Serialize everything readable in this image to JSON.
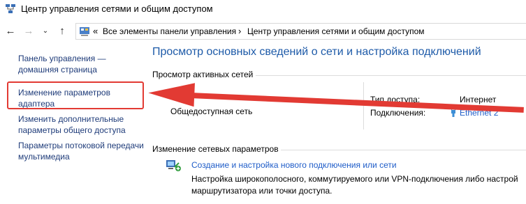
{
  "window": {
    "title": "Центр управления сетями и общим доступом",
    "icon": "network-center-icon"
  },
  "nav": {
    "back_icon": "arrow-left-icon",
    "forward_icon": "arrow-right-icon",
    "dropdown_icon": "chevron-down-icon",
    "up_icon": "arrow-up-icon"
  },
  "address": {
    "overflow": "«",
    "crumbs": [
      "Все элементы панели управления",
      "Центр управления сетями и общим доступом"
    ],
    "separator": "›"
  },
  "sidebar": {
    "items": [
      "Панель управления — домашняя страница",
      "Изменение параметров адаптера",
      "Изменить дополнительные параметры общего доступа",
      "Параметры потоковой передачи мультимедиа"
    ]
  },
  "main": {
    "title": "Просмотр основных сведений о сети и настройка подключений",
    "active_networks_label": "Просмотр активных сетей",
    "network_name": "Общедоступная сеть",
    "access_type_label": "Тип доступа:",
    "access_type_value": "Интернет",
    "connections_label": "Подключения:",
    "connections_value": "Ethernet 2",
    "change_settings_label": "Изменение сетевых параметров",
    "task": {
      "link": "Создание и настройка нового подключения или сети",
      "description": "Настройка широкополосного, коммутируемого или VPN-подключения либо настрой маршрутизатора или точки доступа."
    }
  },
  "colors": {
    "accent": "#1d5aa8",
    "link": "#1e5cc8",
    "annotation": "#e23a33"
  }
}
